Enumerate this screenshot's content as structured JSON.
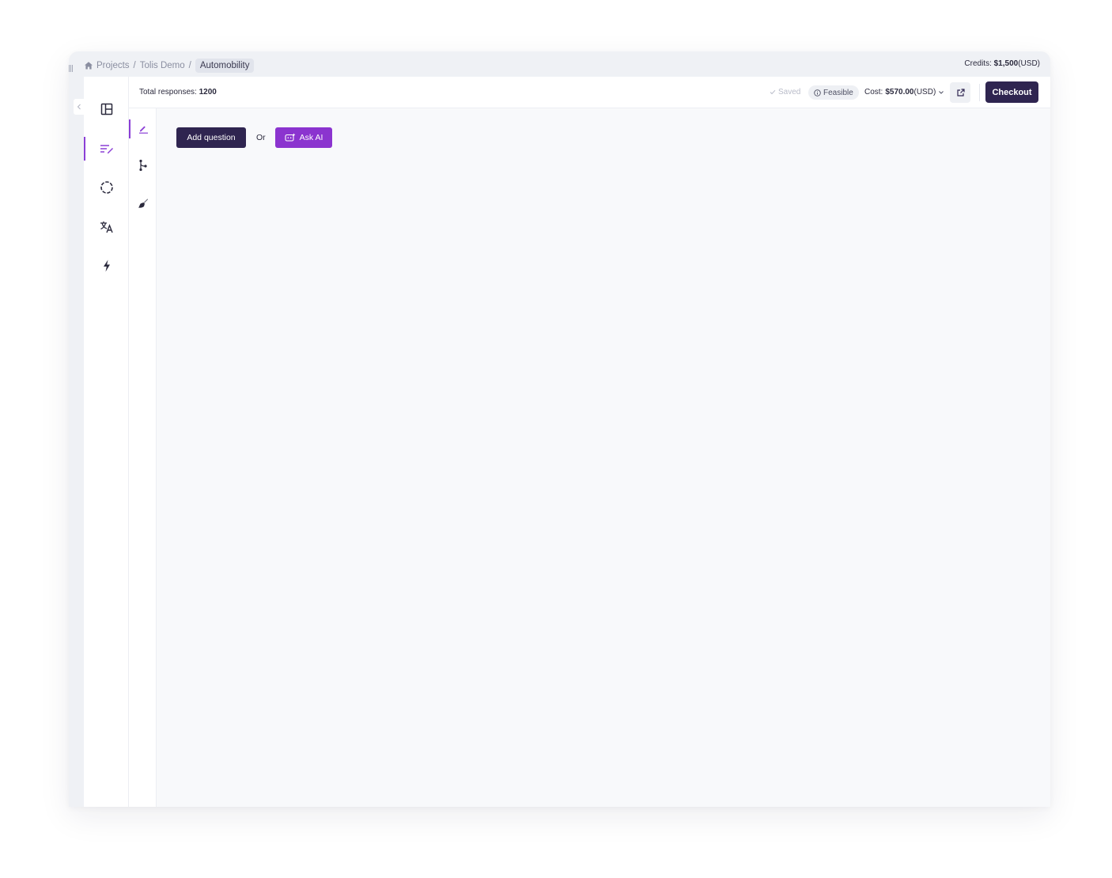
{
  "breadcrumb": {
    "items": [
      "Projects",
      "Tolis Demo"
    ],
    "separator": "/",
    "current": "Automobility"
  },
  "credits": {
    "label": "Credits: ",
    "amount": "$1,500",
    "currency": "(USD)"
  },
  "left_rail": {
    "items": [
      {
        "icon": "layout-icon"
      },
      {
        "icon": "survey-edit-icon",
        "active": true
      },
      {
        "icon": "audience-circle-icon"
      },
      {
        "icon": "translate-icon"
      },
      {
        "icon": "lightning-icon"
      }
    ]
  },
  "sub_rail": {
    "items": [
      {
        "icon": "pencil-icon",
        "active": true
      },
      {
        "icon": "logic-branch-icon"
      },
      {
        "icon": "brush-icon"
      }
    ]
  },
  "topbar": {
    "total_label": "Total responses: ",
    "total_value": "1200",
    "saved": "Saved",
    "feasible": "Feasible",
    "cost_label": "Cost: ",
    "cost_value": "$570.00",
    "cost_currency": "(USD)",
    "checkout": "Checkout"
  },
  "editor": {
    "add_question": "Add question",
    "or": "Or",
    "ask_ai": "Ask AI"
  },
  "colors": {
    "accent": "#8b3fd6",
    "primary_dark": "#2f2550",
    "ai_purple": "#8b34cf"
  }
}
